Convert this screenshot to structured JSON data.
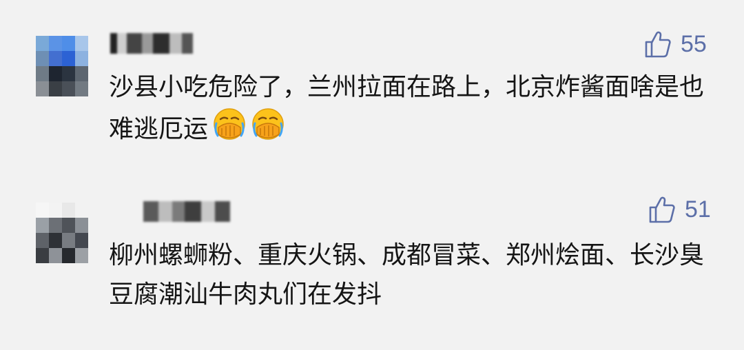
{
  "comments": [
    {
      "username": "",
      "likes": "55",
      "text": "沙县小吃危险了，兰州拉面在路上，北京炸酱面啥是也难逃厄运",
      "emoji": [
        "facepalm-icon",
        "facepalm-icon"
      ]
    },
    {
      "username": "",
      "likes": "51",
      "text": "柳州螺蛳粉、重庆火锅、成都冒菜、郑州烩面、长沙臭豆腐潮汕牛肉丸们在发抖",
      "emoji": []
    }
  ],
  "colors": {
    "background": "#f2f2f2",
    "text": "#151515",
    "like": "#5c6fa8"
  }
}
